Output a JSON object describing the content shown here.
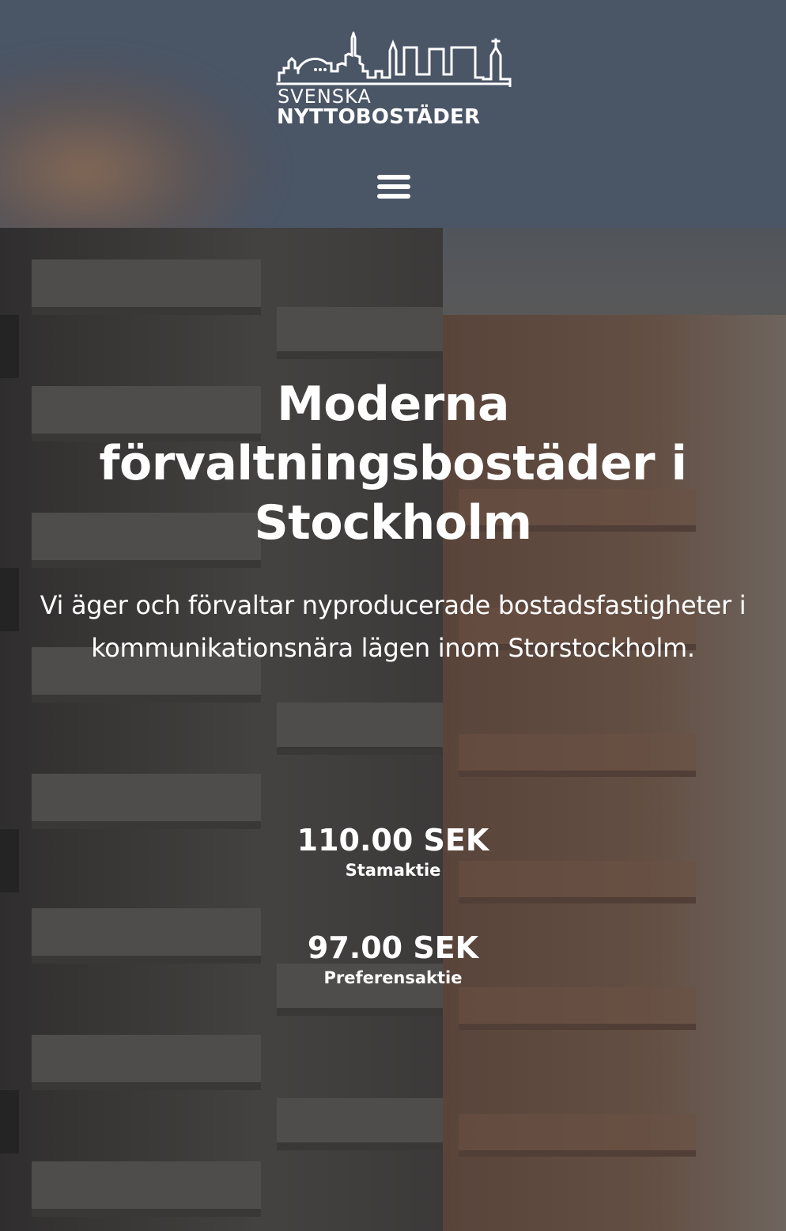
{
  "header": {
    "logo": {
      "line1": "SVENSKA",
      "line2": "NYTTOBOSTÄDER",
      "icon": "stockholm-skyline-icon"
    },
    "menu_icon": "hamburger-menu-icon"
  },
  "hero": {
    "title": "Moderna förvaltningsbostäder i Stockholm",
    "text": "Vi äger och förvaltar nyproducerade bostadsfastigheter i kommunikationsnära lägen inom Storstockholm.",
    "prices": [
      {
        "value": "110.00 SEK",
        "label": "Stamaktie"
      },
      {
        "value": "97.00 SEK",
        "label": "Preferensaktie"
      }
    ]
  },
  "colors": {
    "header_bg": "#4a5566",
    "text": "#ffffff"
  }
}
